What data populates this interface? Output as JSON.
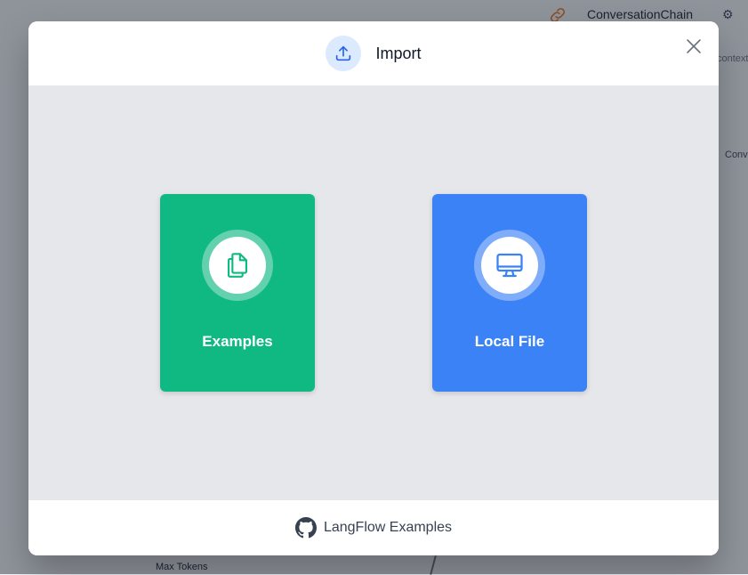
{
  "background": {
    "node_title": "ConversationChain",
    "context_label": "context",
    "conversation_label": "Conversation",
    "max_tokens_label": "Max Tokens"
  },
  "modal": {
    "title": "Import",
    "header_icon": "upload-icon",
    "close_icon": "close-icon",
    "cards": [
      {
        "label": "Examples",
        "icon": "documents-icon",
        "color": "#10b981"
      },
      {
        "label": "Local File",
        "icon": "computer-icon",
        "color": "#3b82f6"
      }
    ],
    "footer": {
      "link_label": "LangFlow Examples",
      "icon": "github-icon"
    }
  },
  "colors": {
    "accent_blue": "#3b82f6",
    "accent_green": "#10b981",
    "header_icon_bg": "#dbeafe"
  }
}
